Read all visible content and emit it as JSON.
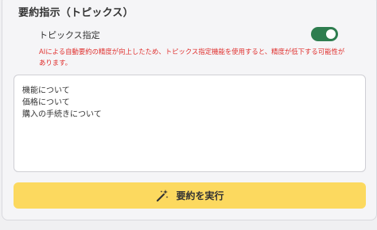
{
  "section": {
    "title": "要約指示（トピックス）"
  },
  "topic_toggle": {
    "label": "トピックス指定",
    "enabled": true,
    "on_color": "#2e7d4f"
  },
  "warning": {
    "text": "AIによる自動要約の精度が向上したため、トピックス指定機能を使用すると、精度が低下する可能性があります。",
    "color": "#e0302e"
  },
  "topics": {
    "value": "機能について\n価格について\n購入の手続きについて"
  },
  "run_button": {
    "label": "要約を実行",
    "icon": "magic-wand-icon",
    "color": "#fcd95f"
  }
}
